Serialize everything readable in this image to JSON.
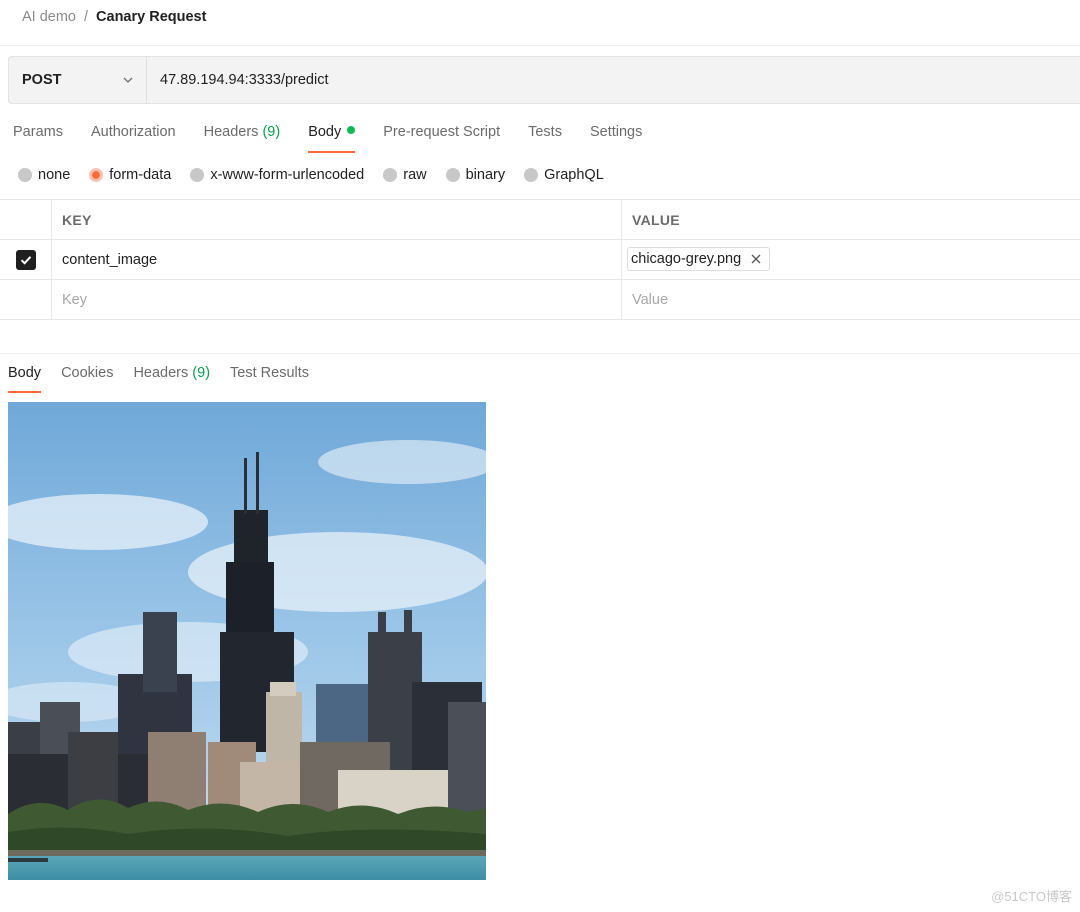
{
  "breadcrumb": {
    "parent": "AI demo",
    "separator": "/",
    "current": "Canary Request"
  },
  "request": {
    "method": "POST",
    "url": "47.89.194.94:3333/predict"
  },
  "request_tabs": [
    {
      "label": "Params"
    },
    {
      "label": "Authorization"
    },
    {
      "label": "Headers",
      "count": "(9)"
    },
    {
      "label": "Body",
      "active": true,
      "indicator": "green-dot"
    },
    {
      "label": "Pre-request Script"
    },
    {
      "label": "Tests"
    },
    {
      "label": "Settings"
    }
  ],
  "body_types": [
    {
      "label": "none",
      "selected": false
    },
    {
      "label": "form-data",
      "selected": true
    },
    {
      "label": "x-www-form-urlencoded",
      "selected": false
    },
    {
      "label": "raw",
      "selected": false
    },
    {
      "label": "binary",
      "selected": false
    },
    {
      "label": "GraphQL",
      "selected": false
    }
  ],
  "params_table": {
    "headers": {
      "key": "KEY",
      "value": "VALUE"
    },
    "rows": [
      {
        "checked": true,
        "key": "content_image",
        "value": "chicago-grey.png"
      }
    ],
    "empty_row": {
      "key_placeholder": "Key",
      "value_placeholder": "Value"
    }
  },
  "response_tabs": [
    {
      "label": "Body",
      "active": true
    },
    {
      "label": "Cookies"
    },
    {
      "label": "Headers",
      "count": "(9)"
    },
    {
      "label": "Test Results"
    }
  ],
  "watermark": "@51CTO博客",
  "colors": {
    "accent": "#ff6c37",
    "count_green": "#0a9f4f",
    "dot_green": "#0cbb52"
  }
}
